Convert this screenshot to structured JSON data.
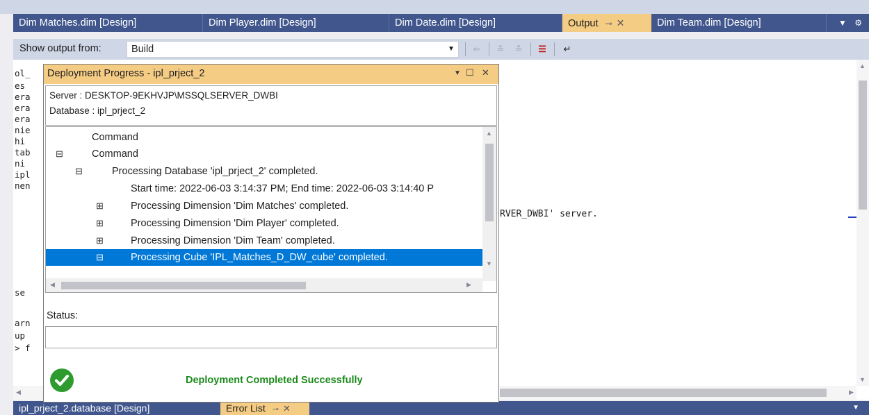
{
  "document_tabs": [
    {
      "label": "Dim Matches.dim [Design]",
      "active": false
    },
    {
      "label": "Dim Player.dim [Design]",
      "active": false
    },
    {
      "label": "Dim Date.dim [Design]",
      "active": false
    },
    {
      "label": "Output",
      "active": true
    },
    {
      "label": "Dim Team.dim [Design]",
      "active": false
    }
  ],
  "icons": {
    "pin": "pin-icon",
    "close": "close-icon",
    "dropdown": "chevron-down-icon",
    "settings": "gear-icon",
    "success": "check-circle-icon",
    "expand": "plus-box-icon",
    "collapse": "minus-box-icon",
    "maximize": "maximize-icon"
  },
  "toolbar": {
    "show_output_label": "Show output from:",
    "source_value": "Build"
  },
  "output": {
    "visible_fragments": [
      "ol_",
      "es",
      "era",
      "era",
      "era",
      "nie",
      "hi",
      "tab",
      "ni",
      "ipl",
      "nen",
      "se",
      "arn",
      "up",
      "> f"
    ],
    "tail_text": "RVER_DWBI' server."
  },
  "dialog": {
    "title": "Deployment Progress - ipl_prject_2",
    "server_line": "Server : DESKTOP-9EKHVJP\\MSSQLSERVER_DWBI",
    "database_line": "Database : ipl_prject_2",
    "tree": [
      {
        "label": "Command",
        "toggle": "",
        "level": 0,
        "selected": false
      },
      {
        "label": "Command",
        "toggle": "⊟",
        "level": 0,
        "selected": false
      },
      {
        "label": "Processing Database 'ipl_prject_2' completed.",
        "toggle": "⊟",
        "level": 1,
        "selected": false
      },
      {
        "label": "Start time: 2022-06-03 3:14:37 PM; End time: 2022-06-03 3:14:40 P",
        "toggle": "",
        "level": 2,
        "selected": false
      },
      {
        "label": "Processing Dimension 'Dim Matches' completed.",
        "toggle": "⊞",
        "level": 2,
        "selected": false
      },
      {
        "label": "Processing Dimension 'Dim Player' completed.",
        "toggle": "⊞",
        "level": 2,
        "selected": false
      },
      {
        "label": "Processing Dimension 'Dim Team' completed.",
        "toggle": "⊞",
        "level": 2,
        "selected": false
      },
      {
        "label": "Processing Cube 'IPL_Matches_D_DW_cube' completed.",
        "toggle": "⊟",
        "level": 2,
        "selected": true
      }
    ],
    "status_label": "Status:",
    "status_value": "",
    "result_text": "Deployment Completed Successfully"
  },
  "bottom_tabs": [
    {
      "label": "ipl_prject_2.database [Design]",
      "active": false
    },
    {
      "label": "Error List",
      "active": true
    }
  ],
  "colors": {
    "tab_bar": "#40568d",
    "active_tab": "#f5cc84",
    "selection": "#0078d7",
    "success": "#1a8a1a"
  }
}
